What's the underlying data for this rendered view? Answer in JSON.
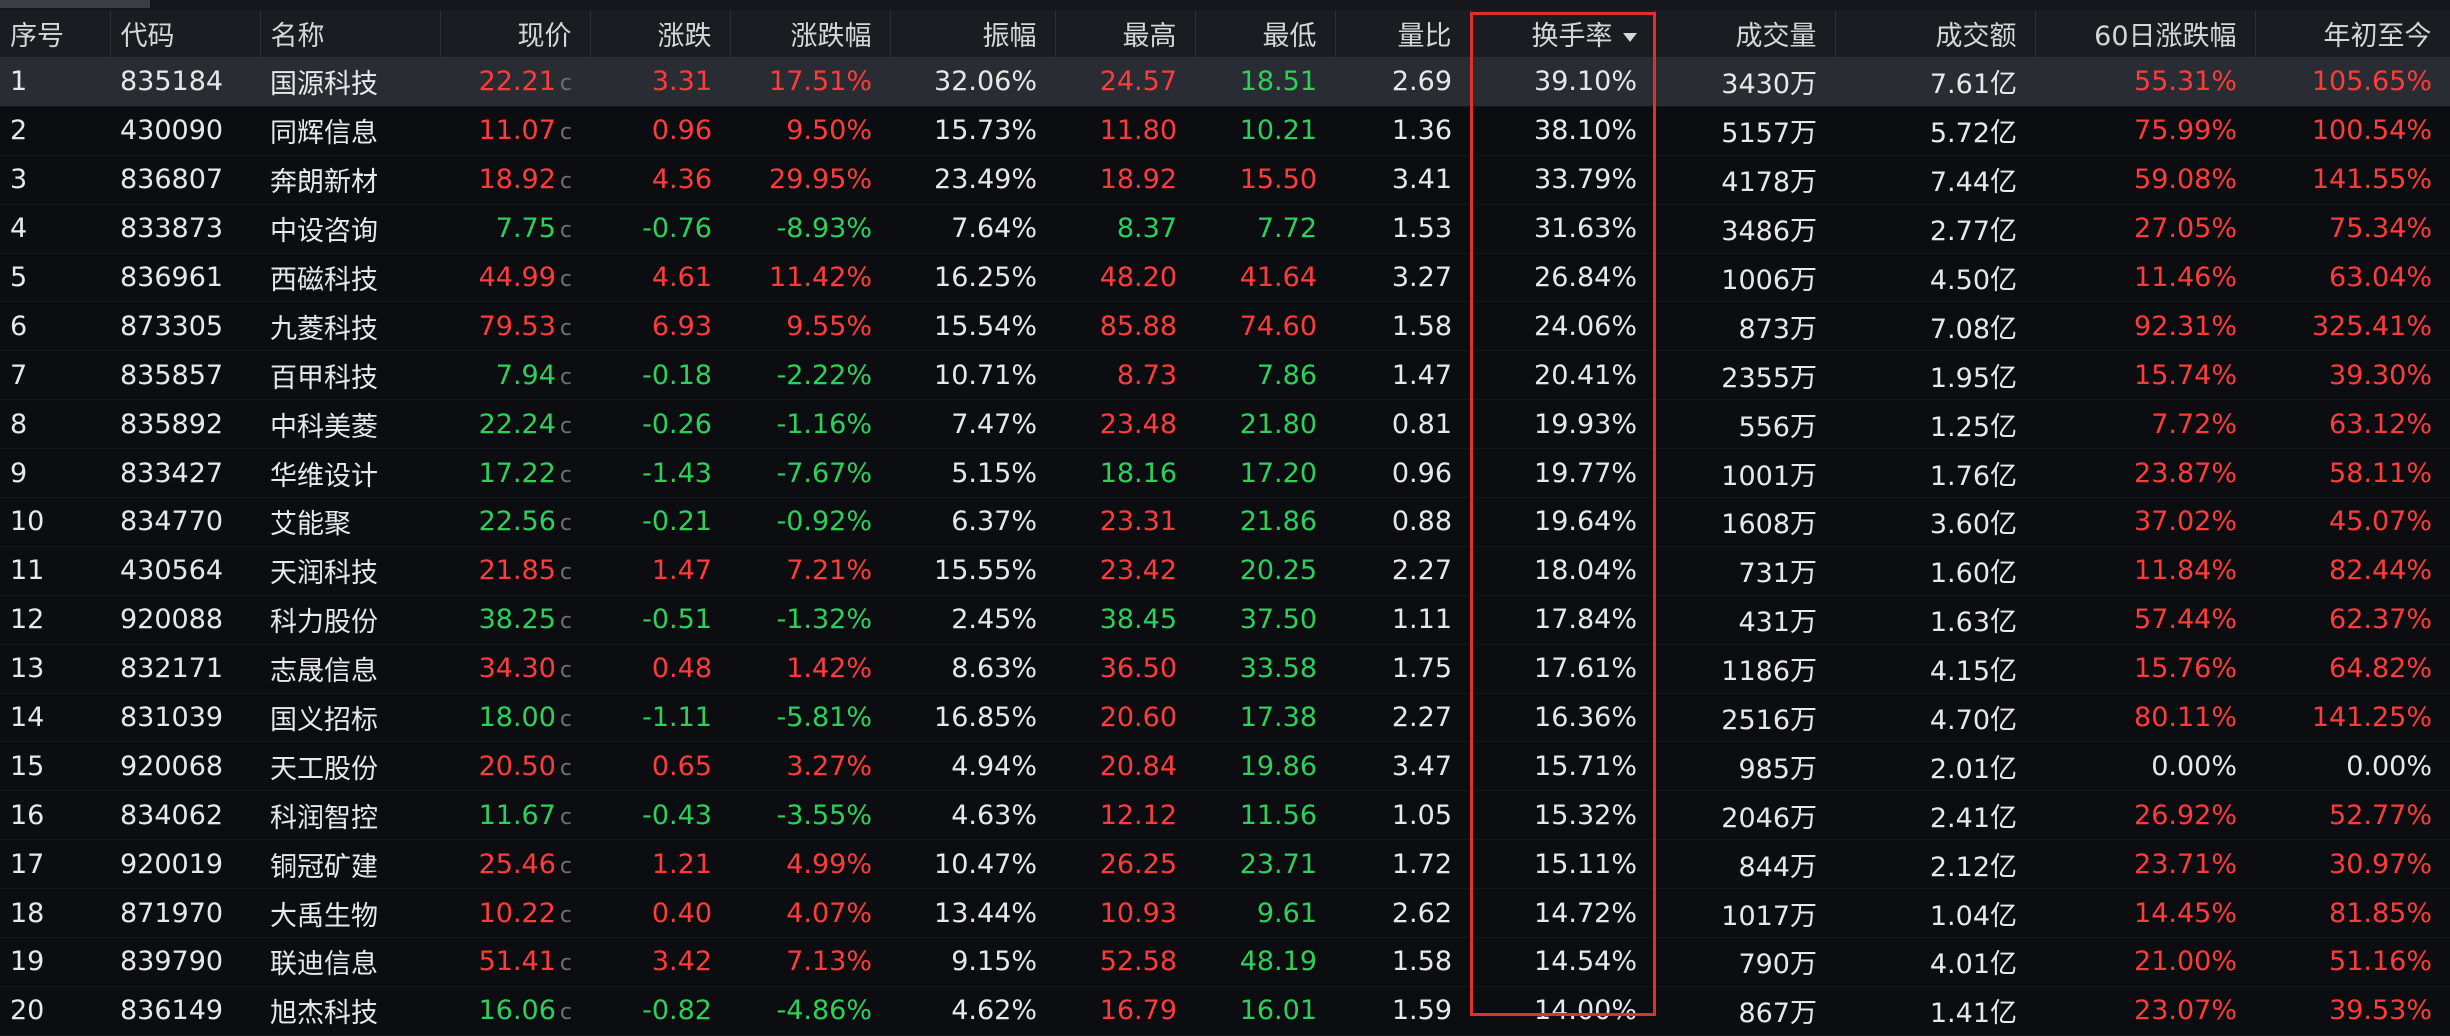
{
  "columns": [
    "序号",
    "代码",
    "名称",
    "现价",
    "涨跌",
    "涨跌幅",
    "振幅",
    "最高",
    "最低",
    "量比",
    "换手率",
    "成交量",
    "成交额",
    "60日涨跌幅",
    "年初至今"
  ],
  "sorted_column": "换手率",
  "price_suffix": "c",
  "colors": {
    "up": "#ff3b3b",
    "down": "#2bd15b",
    "highlight": "#e0302e"
  },
  "rows": [
    {
      "idx": "1",
      "code": "835184",
      "name": "国源科技",
      "price": "22.21",
      "change": "3.31",
      "pct": "17.51%",
      "amp": "32.06%",
      "high": "24.57",
      "low": "18.51",
      "vr": "2.69",
      "turnover": "39.10%",
      "vol": "3430万",
      "amt": "7.61亿",
      "d60": "55.31%",
      "ytd": "105.65%",
      "c": {
        "price": "up",
        "change": "up",
        "pct": "up",
        "high": "up",
        "low": "down",
        "d60": "up",
        "ytd": "up"
      }
    },
    {
      "idx": "2",
      "code": "430090",
      "name": "同辉信息",
      "price": "11.07",
      "change": "0.96",
      "pct": "9.50%",
      "amp": "15.73%",
      "high": "11.80",
      "low": "10.21",
      "vr": "1.36",
      "turnover": "38.10%",
      "vol": "5157万",
      "amt": "5.72亿",
      "d60": "75.99%",
      "ytd": "100.54%",
      "c": {
        "price": "up",
        "change": "up",
        "pct": "up",
        "high": "up",
        "low": "down",
        "d60": "up",
        "ytd": "up"
      }
    },
    {
      "idx": "3",
      "code": "836807",
      "name": "奔朗新材",
      "price": "18.92",
      "change": "4.36",
      "pct": "29.95%",
      "amp": "23.49%",
      "high": "18.92",
      "low": "15.50",
      "vr": "3.41",
      "turnover": "33.79%",
      "vol": "4178万",
      "amt": "7.44亿",
      "d60": "59.08%",
      "ytd": "141.55%",
      "c": {
        "price": "up",
        "change": "up",
        "pct": "up",
        "high": "up",
        "low": "up",
        "d60": "up",
        "ytd": "up"
      }
    },
    {
      "idx": "4",
      "code": "833873",
      "name": "中设咨询",
      "price": "7.75",
      "change": "-0.76",
      "pct": "-8.93%",
      "amp": "7.64%",
      "high": "8.37",
      "low": "7.72",
      "vr": "1.53",
      "turnover": "31.63%",
      "vol": "3486万",
      "amt": "2.77亿",
      "d60": "27.05%",
      "ytd": "75.34%",
      "c": {
        "price": "down",
        "change": "down",
        "pct": "down",
        "high": "down",
        "low": "down",
        "d60": "up",
        "ytd": "up"
      }
    },
    {
      "idx": "5",
      "code": "836961",
      "name": "西磁科技",
      "price": "44.99",
      "change": "4.61",
      "pct": "11.42%",
      "amp": "16.25%",
      "high": "48.20",
      "low": "41.64",
      "vr": "3.27",
      "turnover": "26.84%",
      "vol": "1006万",
      "amt": "4.50亿",
      "d60": "11.46%",
      "ytd": "63.04%",
      "c": {
        "price": "up",
        "change": "up",
        "pct": "up",
        "high": "up",
        "low": "up",
        "d60": "up",
        "ytd": "up"
      }
    },
    {
      "idx": "6",
      "code": "873305",
      "name": "九菱科技",
      "price": "79.53",
      "change": "6.93",
      "pct": "9.55%",
      "amp": "15.54%",
      "high": "85.88",
      "low": "74.60",
      "vr": "1.58",
      "turnover": "24.06%",
      "vol": "873万",
      "amt": "7.08亿",
      "d60": "92.31%",
      "ytd": "325.41%",
      "c": {
        "price": "up",
        "change": "up",
        "pct": "up",
        "high": "up",
        "low": "up",
        "d60": "up",
        "ytd": "up"
      }
    },
    {
      "idx": "7",
      "code": "835857",
      "name": "百甲科技",
      "price": "7.94",
      "change": "-0.18",
      "pct": "-2.22%",
      "amp": "10.71%",
      "high": "8.73",
      "low": "7.86",
      "vr": "1.47",
      "turnover": "20.41%",
      "vol": "2355万",
      "amt": "1.95亿",
      "d60": "15.74%",
      "ytd": "39.30%",
      "c": {
        "price": "down",
        "change": "down",
        "pct": "down",
        "high": "up",
        "low": "down",
        "d60": "up",
        "ytd": "up"
      }
    },
    {
      "idx": "8",
      "code": "835892",
      "name": "中科美菱",
      "price": "22.24",
      "change": "-0.26",
      "pct": "-1.16%",
      "amp": "7.47%",
      "high": "23.48",
      "low": "21.80",
      "vr": "0.81",
      "turnover": "19.93%",
      "vol": "556万",
      "amt": "1.25亿",
      "d60": "7.72%",
      "ytd": "63.12%",
      "c": {
        "price": "down",
        "change": "down",
        "pct": "down",
        "high": "up",
        "low": "down",
        "d60": "up",
        "ytd": "up"
      }
    },
    {
      "idx": "9",
      "code": "833427",
      "name": "华维设计",
      "price": "17.22",
      "change": "-1.43",
      "pct": "-7.67%",
      "amp": "5.15%",
      "high": "18.16",
      "low": "17.20",
      "vr": "0.96",
      "turnover": "19.77%",
      "vol": "1001万",
      "amt": "1.76亿",
      "d60": "23.87%",
      "ytd": "58.11%",
      "c": {
        "price": "down",
        "change": "down",
        "pct": "down",
        "high": "down",
        "low": "down",
        "d60": "up",
        "ytd": "up"
      }
    },
    {
      "idx": "10",
      "code": "834770",
      "name": "艾能聚",
      "price": "22.56",
      "change": "-0.21",
      "pct": "-0.92%",
      "amp": "6.37%",
      "high": "23.31",
      "low": "21.86",
      "vr": "0.88",
      "turnover": "19.64%",
      "vol": "1608万",
      "amt": "3.60亿",
      "d60": "37.02%",
      "ytd": "45.07%",
      "c": {
        "price": "down",
        "change": "down",
        "pct": "down",
        "high": "up",
        "low": "down",
        "d60": "up",
        "ytd": "up"
      }
    },
    {
      "idx": "11",
      "code": "430564",
      "name": "天润科技",
      "price": "21.85",
      "change": "1.47",
      "pct": "7.21%",
      "amp": "15.55%",
      "high": "23.42",
      "low": "20.25",
      "vr": "2.27",
      "turnover": "18.04%",
      "vol": "731万",
      "amt": "1.60亿",
      "d60": "11.84%",
      "ytd": "82.44%",
      "c": {
        "price": "up",
        "change": "up",
        "pct": "up",
        "high": "up",
        "low": "down",
        "d60": "up",
        "ytd": "up"
      }
    },
    {
      "idx": "12",
      "code": "920088",
      "name": "科力股份",
      "price": "38.25",
      "change": "-0.51",
      "pct": "-1.32%",
      "amp": "2.45%",
      "high": "38.45",
      "low": "37.50",
      "vr": "1.11",
      "turnover": "17.84%",
      "vol": "431万",
      "amt": "1.63亿",
      "d60": "57.44%",
      "ytd": "62.37%",
      "c": {
        "price": "down",
        "change": "down",
        "pct": "down",
        "high": "down",
        "low": "down",
        "d60": "up",
        "ytd": "up"
      }
    },
    {
      "idx": "13",
      "code": "832171",
      "name": "志晟信息",
      "price": "34.30",
      "change": "0.48",
      "pct": "1.42%",
      "amp": "8.63%",
      "high": "36.50",
      "low": "33.58",
      "vr": "1.75",
      "turnover": "17.61%",
      "vol": "1186万",
      "amt": "4.15亿",
      "d60": "15.76%",
      "ytd": "64.82%",
      "c": {
        "price": "up",
        "change": "up",
        "pct": "up",
        "high": "up",
        "low": "down",
        "d60": "up",
        "ytd": "up"
      }
    },
    {
      "idx": "14",
      "code": "831039",
      "name": "国义招标",
      "price": "18.00",
      "change": "-1.11",
      "pct": "-5.81%",
      "amp": "16.85%",
      "high": "20.60",
      "low": "17.38",
      "vr": "2.27",
      "turnover": "16.36%",
      "vol": "2516万",
      "amt": "4.70亿",
      "d60": "80.11%",
      "ytd": "141.25%",
      "c": {
        "price": "down",
        "change": "down",
        "pct": "down",
        "high": "up",
        "low": "down",
        "d60": "up",
        "ytd": "up"
      }
    },
    {
      "idx": "15",
      "code": "920068",
      "name": "天工股份",
      "price": "20.50",
      "change": "0.65",
      "pct": "3.27%",
      "amp": "4.94%",
      "high": "20.84",
      "low": "19.86",
      "vr": "3.47",
      "turnover": "15.71%",
      "vol": "985万",
      "amt": "2.01亿",
      "d60": "0.00%",
      "ytd": "0.00%",
      "c": {
        "price": "up",
        "change": "up",
        "pct": "up",
        "high": "up",
        "low": "down",
        "d60": "flat",
        "ytd": "flat"
      }
    },
    {
      "idx": "16",
      "code": "834062",
      "name": "科润智控",
      "price": "11.67",
      "change": "-0.43",
      "pct": "-3.55%",
      "amp": "4.63%",
      "high": "12.12",
      "low": "11.56",
      "vr": "1.05",
      "turnover": "15.32%",
      "vol": "2046万",
      "amt": "2.41亿",
      "d60": "26.92%",
      "ytd": "52.77%",
      "c": {
        "price": "down",
        "change": "down",
        "pct": "down",
        "high": "up",
        "low": "down",
        "d60": "up",
        "ytd": "up"
      }
    },
    {
      "idx": "17",
      "code": "920019",
      "name": "铜冠矿建",
      "price": "25.46",
      "change": "1.21",
      "pct": "4.99%",
      "amp": "10.47%",
      "high": "26.25",
      "low": "23.71",
      "vr": "1.72",
      "turnover": "15.11%",
      "vol": "844万",
      "amt": "2.12亿",
      "d60": "23.71%",
      "ytd": "30.97%",
      "c": {
        "price": "up",
        "change": "up",
        "pct": "up",
        "high": "up",
        "low": "down",
        "d60": "up",
        "ytd": "up"
      }
    },
    {
      "idx": "18",
      "code": "871970",
      "name": "大禹生物",
      "price": "10.22",
      "change": "0.40",
      "pct": "4.07%",
      "amp": "13.44%",
      "high": "10.93",
      "low": "9.61",
      "vr": "2.62",
      "turnover": "14.72%",
      "vol": "1017万",
      "amt": "1.04亿",
      "d60": "14.45%",
      "ytd": "81.85%",
      "c": {
        "price": "up",
        "change": "up",
        "pct": "up",
        "high": "up",
        "low": "down",
        "d60": "up",
        "ytd": "up"
      }
    },
    {
      "idx": "19",
      "code": "839790",
      "name": "联迪信息",
      "price": "51.41",
      "change": "3.42",
      "pct": "7.13%",
      "amp": "9.15%",
      "high": "52.58",
      "low": "48.19",
      "vr": "1.58",
      "turnover": "14.54%",
      "vol": "790万",
      "amt": "4.01亿",
      "d60": "21.00%",
      "ytd": "51.16%",
      "c": {
        "price": "up",
        "change": "up",
        "pct": "up",
        "high": "up",
        "low": "down",
        "d60": "up",
        "ytd": "up"
      }
    },
    {
      "idx": "20",
      "code": "836149",
      "name": "旭杰科技",
      "price": "16.06",
      "change": "-0.82",
      "pct": "-4.86%",
      "amp": "4.62%",
      "high": "16.79",
      "low": "16.01",
      "vr": "1.59",
      "turnover": "14.00%",
      "vol": "867万",
      "amt": "1.41亿",
      "d60": "23.07%",
      "ytd": "39.53%",
      "c": {
        "price": "down",
        "change": "down",
        "pct": "down",
        "high": "up",
        "low": "down",
        "d60": "up",
        "ytd": "up"
      }
    }
  ]
}
